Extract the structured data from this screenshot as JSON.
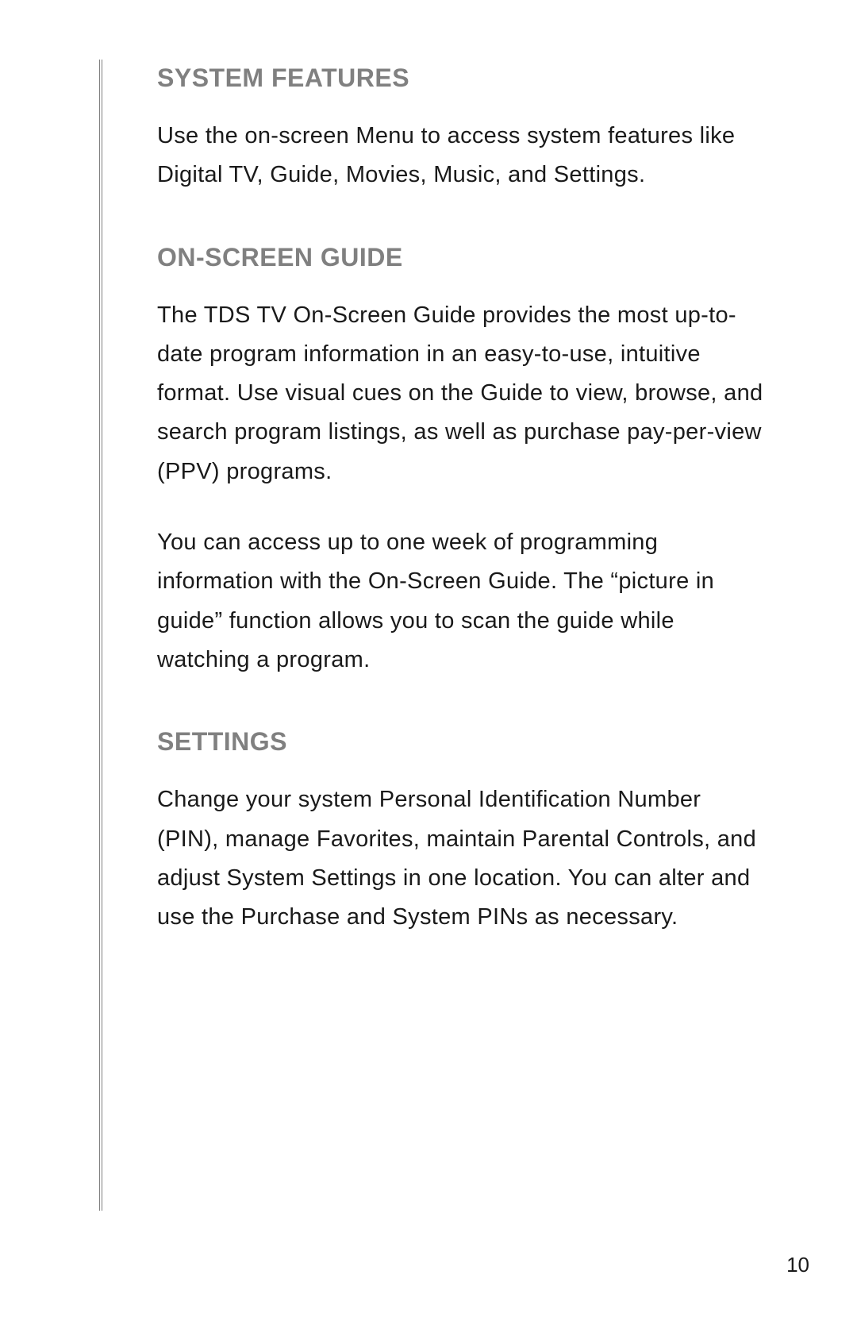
{
  "sections": [
    {
      "heading": "SYSTEM FEATURES",
      "paragraphs": [
        "Use the on-screen Menu to access system features like Digital TV, Guide, Movies, Music, and Settings."
      ]
    },
    {
      "heading": "ON-SCREEN GUIDE",
      "paragraphs": [
        "The TDS TV On-Screen Guide provides the most up-to-date program information in an easy-to-use, intuitive format. Use visual cues on the Guide to view, browse, and search program listings, as well as purchase pay-per-view (PPV) programs.",
        "You can access up to one week of programming information with the On-Screen Guide. The “picture in guide” function allows you to scan the guide while watching a program."
      ]
    },
    {
      "heading": "SETTINGS",
      "paragraphs": [
        "Change your system Personal Identification Number (PIN), manage Favorites, maintain Parental Controls, and adjust System Settings in one location. You can alter and use the Purchase and System PINs as necessary."
      ]
    }
  ],
  "page_number": "10"
}
